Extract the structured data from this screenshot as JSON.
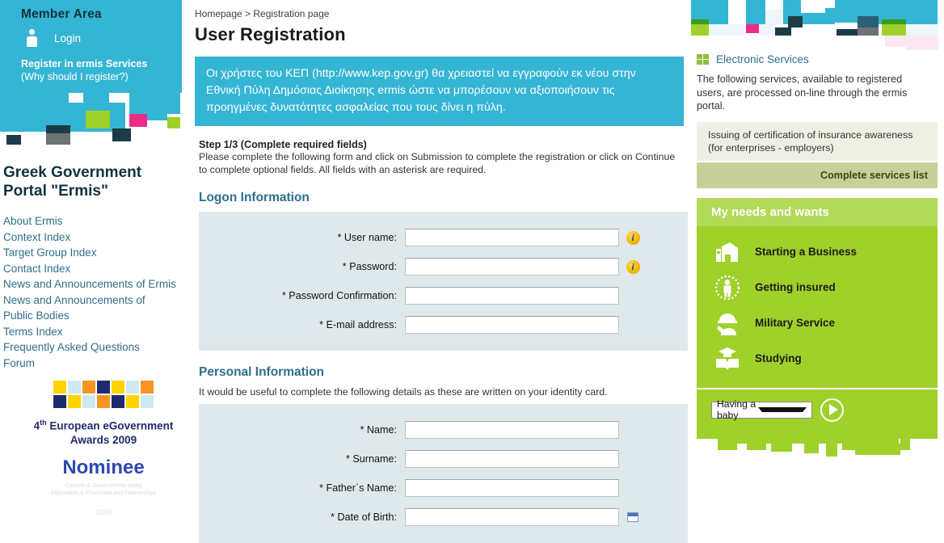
{
  "left": {
    "member": {
      "title": "Member Area",
      "login_label": "Login",
      "register_line1": "Register in ermis Services",
      "register_line2": "(Why should I register?)"
    },
    "portal_title": "Greek Government Portal \"Ermis\"",
    "nav": [
      "About Ermis",
      "Context Index",
      "Target Group Index",
      "Contact Index",
      "News and Announcements of Ermis",
      "News and Announcements of Public Bodies",
      "Terms Index",
      "Frequently Asked Questions",
      "Forum"
    ],
    "award": {
      "line1_sup": "th",
      "line1_pre": "4",
      "line1": " European eGovernment",
      "line2": "Awards 2009",
      "nominee": "Nominee",
      "fine1": "Citizens & Governments doing",
      "fine2": "information & Processes and Partnerships",
      "fine3": "2009"
    }
  },
  "center": {
    "breadcrumb": "Homepage > Registration page",
    "title": "User Registration",
    "notice": "Οι χρήστες του ΚΕΠ (http://www.kep.gov.gr) θα χρειαστεί να εγγραφούν εκ νέου στην Εθνική Πύλη Δημόσιας Διοίκησης ermis ώστε να μπορέσουν να αξιοποιήσουν τις προηγμένες δυνατότητες ασφαλείας που τους δίνει η πύλη.",
    "step_heading": "Step 1/3 (Complete required fields)",
    "step_text": "Please complete the following form and click on Submission to complete the registration or click on Continue to complete optional fields. All fields with an asterisk are required.",
    "logon_section": {
      "title": "Logon Information",
      "fields": [
        {
          "label": "* User name:",
          "value": "",
          "hint": "info-icon"
        },
        {
          "label": "* Password:",
          "value": "",
          "hint": "info-icon"
        },
        {
          "label": "* Password Confirmation:",
          "value": "",
          "hint": ""
        },
        {
          "label": "* E-mail address:",
          "value": "",
          "hint": ""
        }
      ]
    },
    "personal_section": {
      "title": "Personal Information",
      "note": "It would be useful to complete the following details as these are written on your identity card.",
      "fields": [
        {
          "label": "* Name:",
          "value": "",
          "hint": ""
        },
        {
          "label": "* Surname:",
          "value": "",
          "hint": ""
        },
        {
          "label": "* Father`s Name:",
          "value": "",
          "hint": ""
        },
        {
          "label": "* Date of Birth:",
          "value": "",
          "hint": "calendar-icon"
        }
      ]
    }
  },
  "right": {
    "electronic_services": {
      "label": "Electronic Services",
      "description": "The following services, available to registered users, are processed on-line through the ermis portal.",
      "items": [
        "Issuing of certification of insurance awareness (for enterprises - employers)"
      ],
      "complete_list": "Complete services list"
    },
    "needs": {
      "title": "My needs and wants",
      "items": [
        {
          "label": "Starting a Business",
          "icon": "factory-icon"
        },
        {
          "label": "Getting insured",
          "icon": "insurance-person-icon"
        },
        {
          "label": "Military Service",
          "icon": "soldier-icon"
        },
        {
          "label": "Studying",
          "icon": "graduate-book-icon"
        }
      ],
      "selected_option": "Having a baby",
      "go_label": "go-arrow-icon"
    }
  },
  "colors": {
    "cyan": "#35b5d4",
    "green": "#a0d02a",
    "green_head": "#b2d958",
    "magenta": "#ec2b84",
    "dark_navy": "#1d3b47",
    "grey": "#6d7275",
    "panel": "#dfe9ec",
    "link": "#2e6e8e"
  }
}
